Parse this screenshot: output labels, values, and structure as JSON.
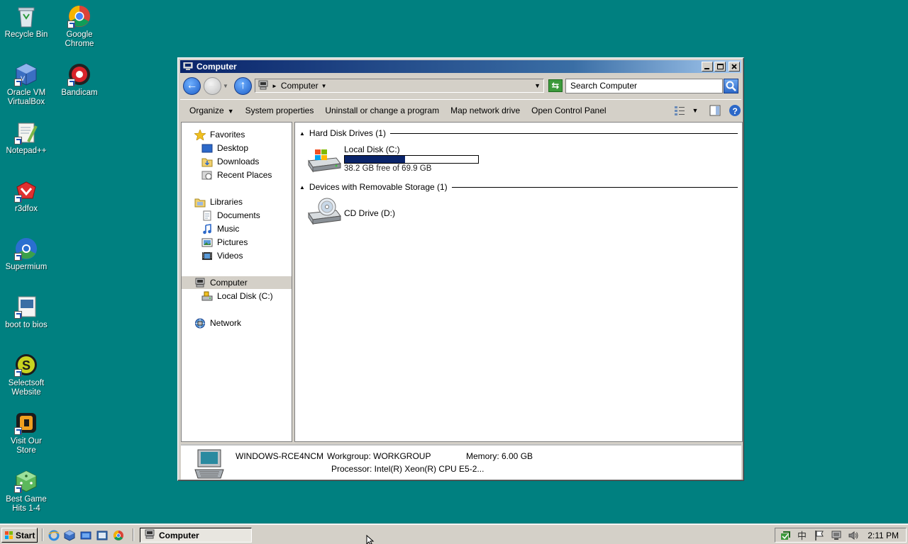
{
  "desktop": {
    "icons": [
      {
        "label": "Recycle Bin"
      },
      {
        "label": "Google Chrome"
      },
      {
        "label": "Oracle VM VirtualBox"
      },
      {
        "label": "Bandicam"
      },
      {
        "label": "Notepad++"
      },
      {
        "label": "r3dfox"
      },
      {
        "label": "Supermium"
      },
      {
        "label": "boot to bios"
      },
      {
        "label": "Selectsoft Website"
      },
      {
        "label": "Visit Our Store"
      },
      {
        "label": "Best Game Hits 1-4"
      }
    ]
  },
  "window": {
    "title": "Computer",
    "address": {
      "crumb": "Computer"
    },
    "search": {
      "placeholder": "Search Computer"
    },
    "commands": {
      "organize": "Organize",
      "system_properties": "System properties",
      "uninstall": "Uninstall or change a program",
      "map_drive": "Map network drive",
      "control_panel": "Open Control Panel"
    },
    "nav": {
      "favorites": "Favorites",
      "desktop": "Desktop",
      "downloads": "Downloads",
      "recent": "Recent Places",
      "libraries": "Libraries",
      "documents": "Documents",
      "music": "Music",
      "pictures": "Pictures",
      "videos": "Videos",
      "computer": "Computer",
      "local_disk": "Local Disk (C:)",
      "network": "Network"
    },
    "sections": {
      "hard_disks": "Hard Disk Drives (1)",
      "removable": "Devices with Removable Storage (1)"
    },
    "drives": {
      "c": {
        "name": "Local Disk (C:)",
        "free": "38.2 GB free of 69.9 GB",
        "used_fraction": 0.45
      },
      "d": {
        "name": "CD Drive (D:)"
      }
    },
    "details": {
      "computer_name": "WINDOWS-RCE4NCM",
      "workgroup": "Workgroup: WORKGROUP",
      "memory": "Memory: 6.00 GB",
      "processor": "Processor: Intel(R) Xeon(R) CPU E5-2..."
    }
  },
  "taskbar": {
    "start": "Start",
    "task": "Computer",
    "clock": "2:11 PM"
  },
  "colors": {
    "desktop": "#008080",
    "title_active": "#0a246a",
    "usage_bar": "#0a246a"
  }
}
